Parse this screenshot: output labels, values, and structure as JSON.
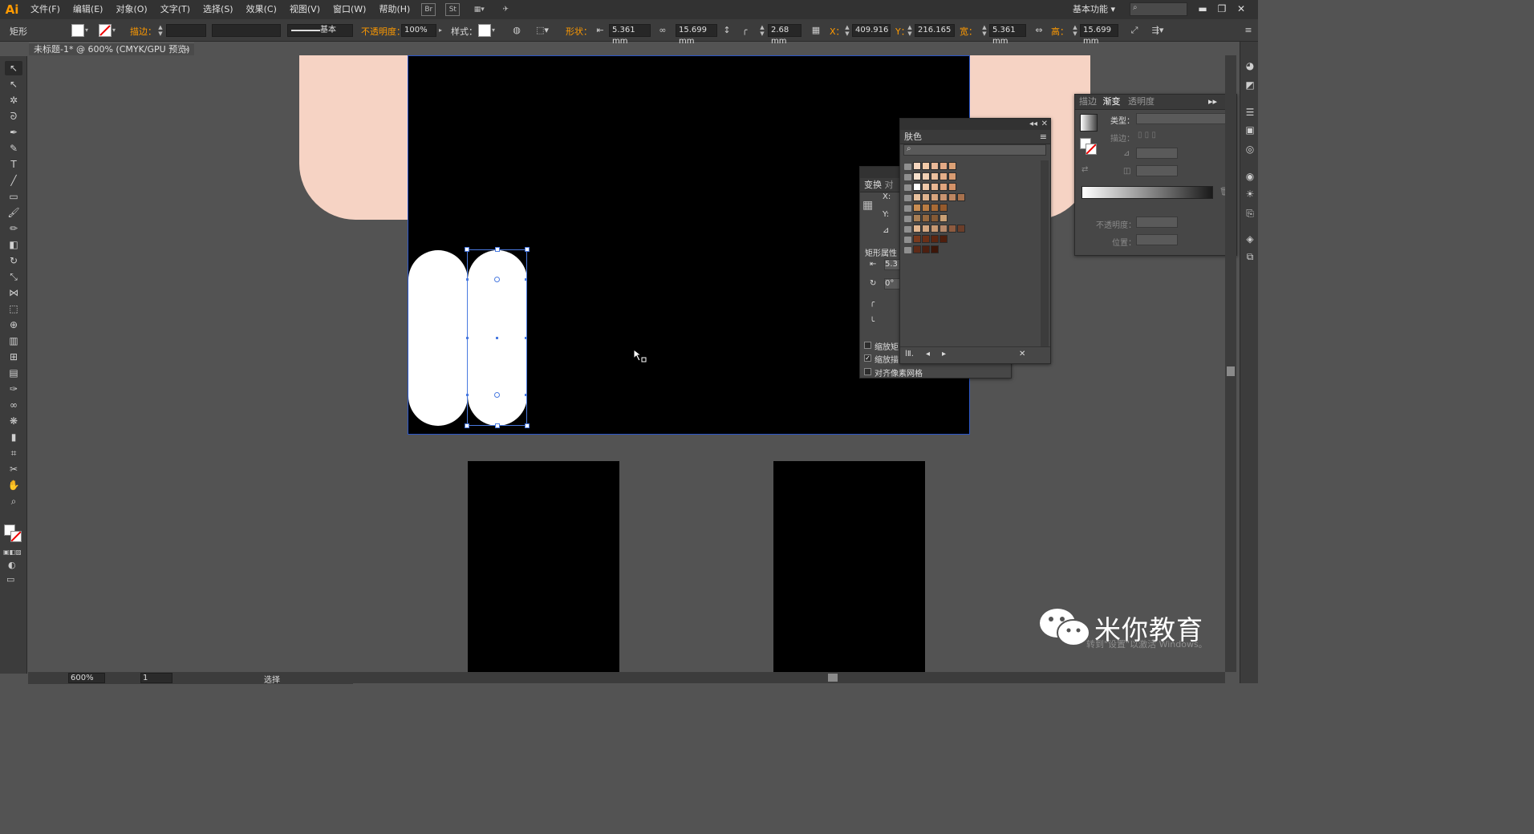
{
  "app": {
    "logo": "Ai",
    "workspace": "基本功能",
    "workspace_caret": "▾"
  },
  "menu": [
    "文件(F)",
    "编辑(E)",
    "对象(O)",
    "文字(T)",
    "选择(S)",
    "效果(C)",
    "视图(V)",
    "窗口(W)",
    "帮助(H)"
  ],
  "menubar_icons": {
    "br": "Br",
    "st": "St",
    "arrange": "▦▾",
    "sync": "✈"
  },
  "window_controls": {
    "minimize": "▬",
    "restore": "❐",
    "close": "✕"
  },
  "control_bar": {
    "object_type": "矩形",
    "stroke_label": "描边：",
    "stroke_style": "基本",
    "opacity_label": "不透明度：",
    "opacity_value": "100%",
    "style_label": "样式：",
    "shape_label": "形状：",
    "width_value": "5.361 mm",
    "height_value": "15.699 mm",
    "corner_value": "2.68 mm",
    "x_label": "X：",
    "x_value": "409.916",
    "y_label": "Y：",
    "y_value": "216.165",
    "w_label": "宽：",
    "w_value": "5.361 mm",
    "h_label": "高：",
    "h_value": "15.699 mm"
  },
  "document_tab": {
    "title": "未标题-1* @ 600% (CMYK/GPU 预览)",
    "close": "×"
  },
  "skin_panel": {
    "title": "肤色",
    "collapse": "◂◂",
    "close": "✕",
    "menu": "≡",
    "lib_icon": "lⅡ.",
    "prev": "◂",
    "next": "▸",
    "delete": "✕"
  },
  "transform_panel": {
    "tab1": "变换",
    "tab2": "对",
    "x_label": "X:",
    "y_label": "Y:",
    "angle_label": "⊿",
    "rect_props": "矩形属性",
    "width_short": "5.3",
    "angle_short": "0°",
    "scale_corners": "缩放矩",
    "scale_strokes": "缩放描",
    "align_pixel": "对齐像素网格",
    "scale_strokes_checked": true
  },
  "gradient_panel": {
    "tab_stroke": "描边",
    "tab_gradient": "渐变",
    "tab_transparency": "透明度",
    "type_label": "类型：",
    "stroke_label": "描边：",
    "opacity_label": "不透明度：",
    "location_label": "位置：",
    "expand": "▸▸",
    "menu": "≡"
  },
  "skin_swatch_rows": [
    [
      "#f5d6bf",
      "#f2c9a7",
      "#eab998",
      "#e3a985",
      "#dca176"
    ],
    [
      "#f7e0cc",
      "#f1cfb3",
      "#ebc09e",
      "#e4ae88",
      "#d99c72"
    ],
    [
      "#ffffff",
      "#efc8a9",
      "#e8b692",
      "#e0a47d",
      "#d49268"
    ],
    [
      "#e8c19d",
      "#deb38e",
      "#d7a47d",
      "#c99470",
      "#bd8661",
      "#a8714d"
    ],
    [
      "#c98d52",
      "#b97c43",
      "#a86a35",
      "#955a2c"
    ],
    [
      "#a97f55",
      "#97693f",
      "#855a35",
      "#c9a075"
    ],
    [
      "#e2b690",
      "#d4a781",
      "#c69872",
      "#b7896b",
      "#8d5a3f",
      "#6b3e2a"
    ],
    [
      "#7a3a1e",
      "#6b2f16",
      "#5c2611",
      "#4e1e0d"
    ],
    [
      "#5d2a18",
      "#4c1f10",
      "#3d1609"
    ]
  ],
  "status_bar": {
    "zoom": "600%",
    "page": "1",
    "tool": "选择"
  },
  "watermark": {
    "brand": "米你教育",
    "system_note": "转到\"设置\"以激活 Windows。"
  },
  "tools": [
    {
      "name": "selection-tool",
      "glyph": "↖"
    },
    {
      "name": "direct-selection-tool",
      "glyph": "↖"
    },
    {
      "name": "magic-wand-tool",
      "glyph": "✲"
    },
    {
      "name": "lasso-tool",
      "glyph": "ᘐ"
    },
    {
      "name": "pen-tool",
      "glyph": "✒"
    },
    {
      "name": "curvature-tool",
      "glyph": "✎"
    },
    {
      "name": "type-tool",
      "glyph": "T"
    },
    {
      "name": "line-tool",
      "glyph": "╱"
    },
    {
      "name": "rectangle-tool",
      "glyph": "▭"
    },
    {
      "name": "paintbrush-tool",
      "glyph": "🖌"
    },
    {
      "name": "pencil-tool",
      "glyph": "✏"
    },
    {
      "name": "eraser-tool",
      "glyph": "◧"
    },
    {
      "name": "rotate-tool",
      "glyph": "↻"
    },
    {
      "name": "scale-tool",
      "glyph": "⤡"
    },
    {
      "name": "width-tool",
      "glyph": "⋈"
    },
    {
      "name": "free-transform-tool",
      "glyph": "⬚"
    },
    {
      "name": "shape-builder-tool",
      "glyph": "⊕"
    },
    {
      "name": "perspective-grid-tool",
      "glyph": "▥"
    },
    {
      "name": "mesh-tool",
      "glyph": "⊞"
    },
    {
      "name": "gradient-tool",
      "glyph": "▤"
    },
    {
      "name": "eyedropper-tool",
      "glyph": "✑"
    },
    {
      "name": "blend-tool",
      "glyph": "∞"
    },
    {
      "name": "symbol-sprayer-tool",
      "glyph": "❋"
    },
    {
      "name": "column-graph-tool",
      "glyph": "▮"
    },
    {
      "name": "artboard-tool",
      "glyph": "⌗"
    },
    {
      "name": "slice-tool",
      "glyph": "✂"
    },
    {
      "name": "hand-tool",
      "glyph": "✋"
    },
    {
      "name": "zoom-tool",
      "glyph": "⌕"
    }
  ]
}
